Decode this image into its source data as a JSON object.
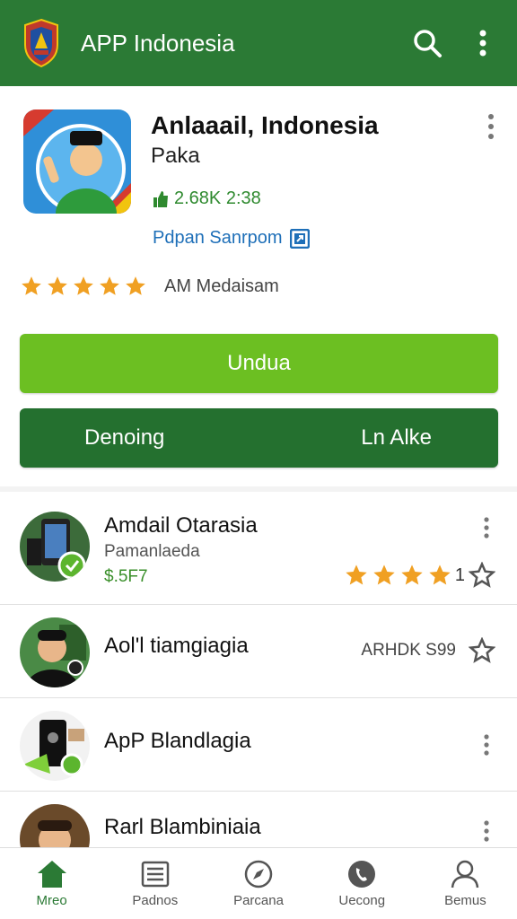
{
  "appbar": {
    "title": "APP Indonesia"
  },
  "app": {
    "name": "Anlaaail, Indonesia",
    "developer": "Paka",
    "count": "2.68K 2:38",
    "link_text": "Pdpan Sanrpom",
    "rating_stars": 5,
    "rating_label": "AM Medaisam"
  },
  "buttons": {
    "primary": "Undua",
    "secondary_left": "Denoing",
    "secondary_right": "Ln Alke"
  },
  "list": [
    {
      "title": "Amdail Otarasia",
      "subtitle": "Pamanlaeda",
      "price": "$.5F7",
      "stars": 4,
      "star_count": "1"
    },
    {
      "title": "Aol'l tiamgiagia",
      "right_text": "ARHDK S99"
    },
    {
      "title": "ApP Blandlagia"
    },
    {
      "title": "Rarl Blambiniaia"
    }
  ],
  "nav": [
    {
      "label": "Mreo",
      "icon": "home-icon"
    },
    {
      "label": "Padnos",
      "icon": "news-icon"
    },
    {
      "label": "Parcana",
      "icon": "compass-icon"
    },
    {
      "label": "Uecong",
      "icon": "phone-icon"
    },
    {
      "label": "Bemus",
      "icon": "person-icon"
    }
  ],
  "colors": {
    "primary": "#2b7a35",
    "accent": "#6cbf22",
    "star": "#f0a023",
    "link": "#1e6fb8"
  }
}
